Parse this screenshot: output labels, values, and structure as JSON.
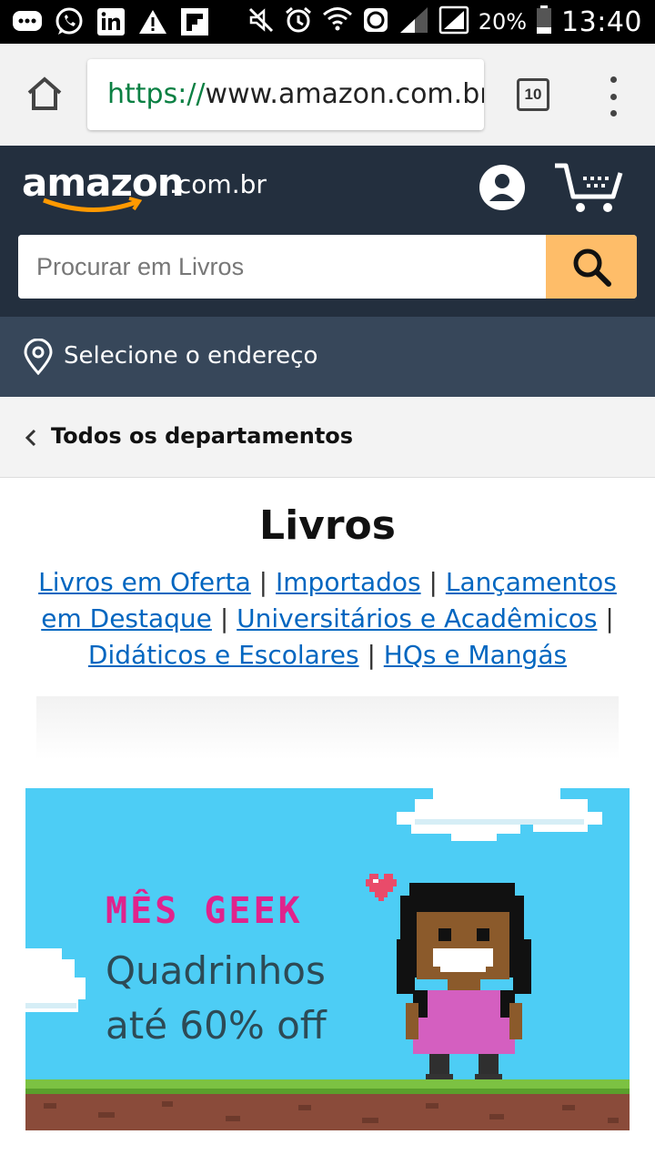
{
  "status_bar": {
    "battery": "20%",
    "time": "13:40",
    "icons": [
      "messages-icon",
      "whatsapp-icon",
      "linkedin-icon",
      "warning-icon",
      "flipboard-icon",
      "mute-icon",
      "alarm-icon",
      "wifi-icon",
      "data-saver-icon",
      "signal-icon",
      "signal-icon",
      "battery-icon"
    ]
  },
  "browser": {
    "url_scheme": "https://",
    "url_host": "www.amazon.com.br",
    "tab_count": "10"
  },
  "header": {
    "logo_text": "amazon",
    "logo_tld": ".com.br",
    "search_placeholder": "Procurar em Livros"
  },
  "address": {
    "label": "Selecione o endereço"
  },
  "departments": {
    "label": "Todos os departamentos"
  },
  "page": {
    "title": "Livros",
    "links": [
      "Livros em Oferta",
      "Importados",
      "Lançamentos em Destaque",
      "Universitários e Acadêmicos",
      "Didáticos e Escolares",
      "HQs e Mangás"
    ],
    "separator": "|"
  },
  "banner": {
    "title": "MÊS GEEK",
    "line1": "Quadrinhos",
    "line2": "até 60% off"
  },
  "colors": {
    "header_bg": "#232f3e",
    "address_bg": "#37475a",
    "search_button": "#febd69",
    "link": "#0066c0",
    "banner_bg": "#4dcdf5",
    "banner_title": "#e0238c"
  }
}
